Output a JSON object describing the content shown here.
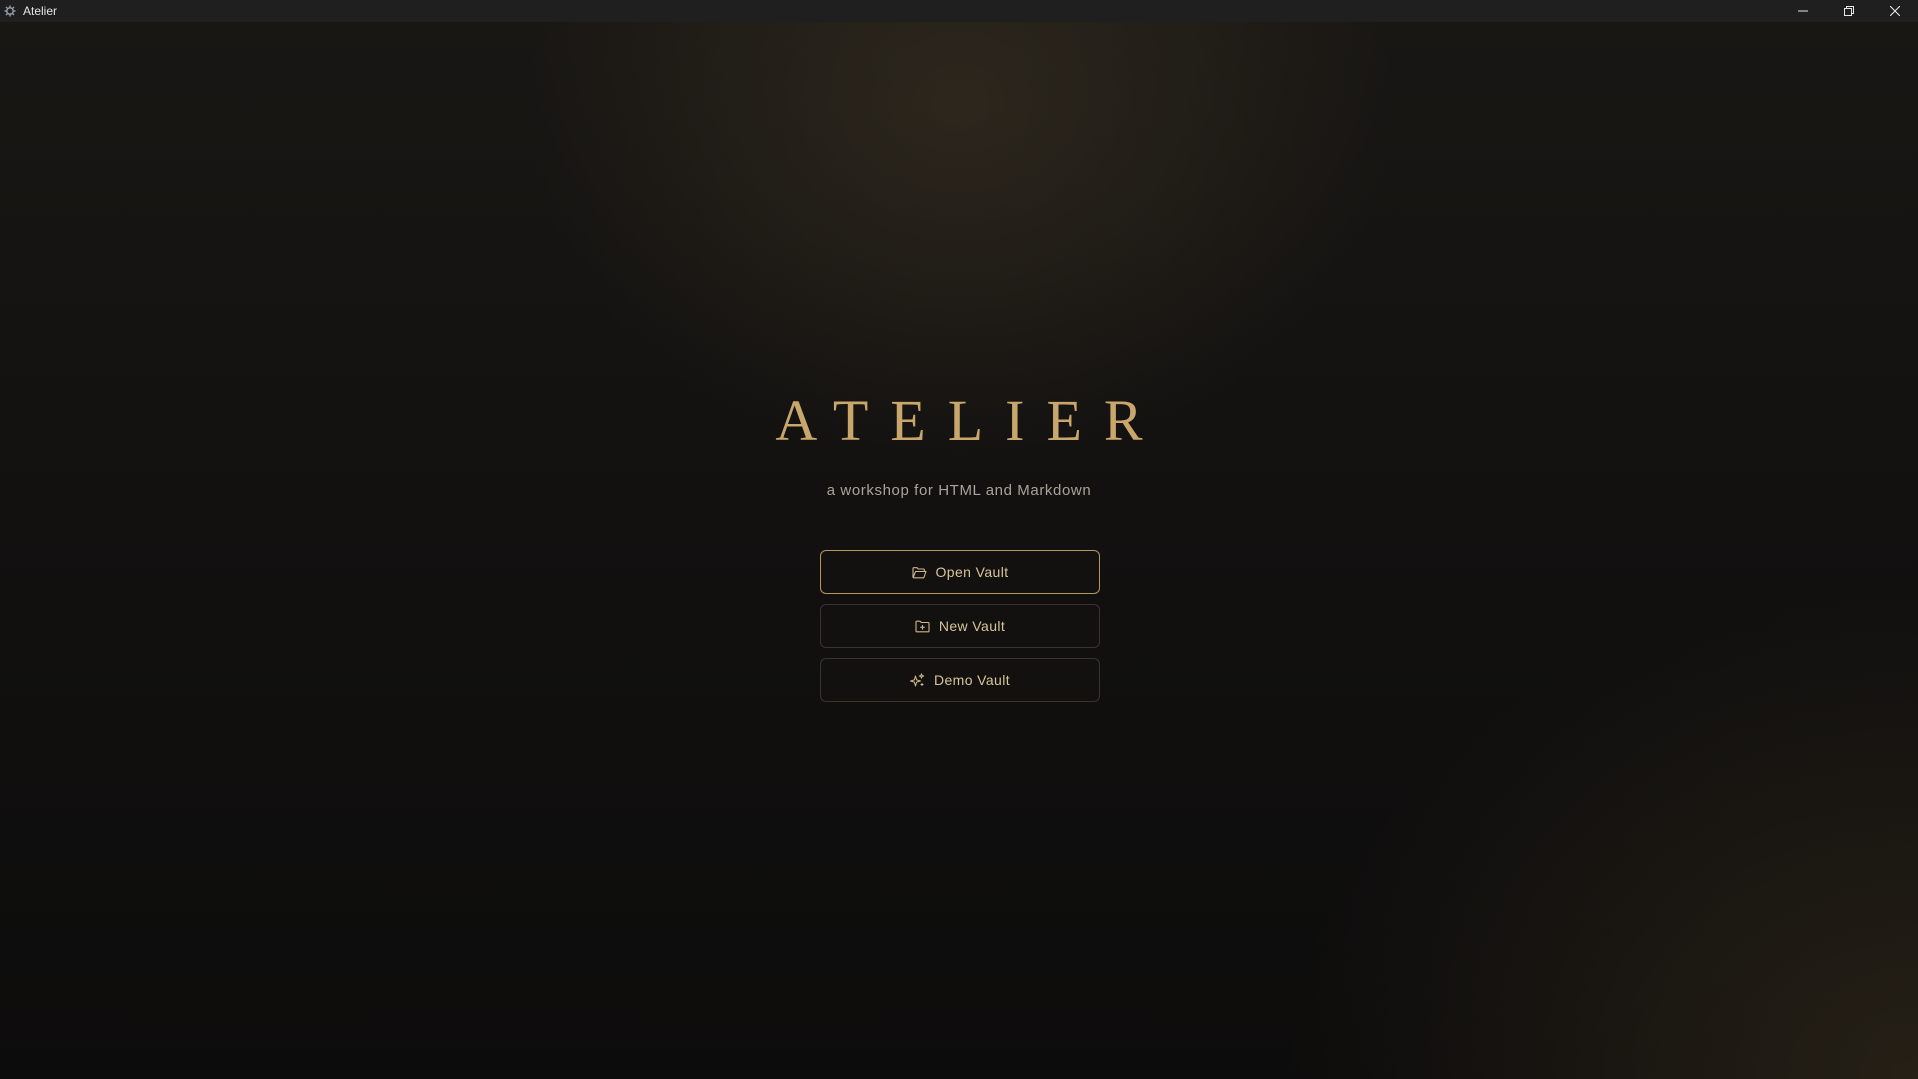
{
  "window": {
    "title": "Atelier",
    "icon": "gear-icon",
    "controls": [
      "minimize-icon",
      "restore-icon",
      "close-icon"
    ]
  },
  "hero": {
    "brand": "ATELIER",
    "tagline": "a workshop for HTML and Markdown"
  },
  "actions": [
    {
      "label": "Open Vault",
      "icon": "folder-open-icon"
    },
    {
      "label": "New Vault",
      "icon": "folder-plus-icon"
    },
    {
      "label": "Demo Vault",
      "icon": "sparkles-icon"
    }
  ],
  "colors": {
    "accent": "#c9a66b",
    "button_text": "#d9c49b",
    "primary_border": "#b89559",
    "background": "#0d0c0b",
    "titlebar": "#1f1f1f"
  }
}
